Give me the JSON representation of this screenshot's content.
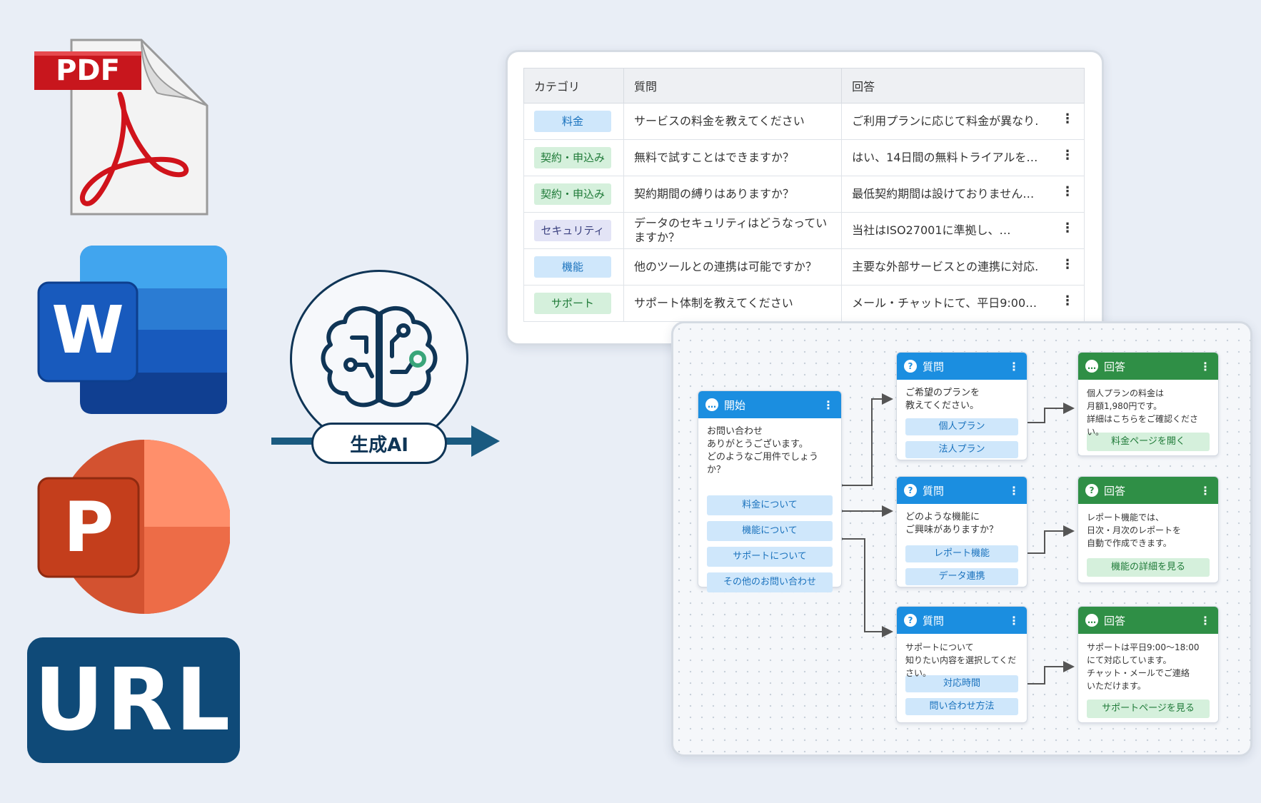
{
  "sources": {
    "pdf_label": "PDF",
    "word_letter": "W",
    "ppt_letter": "P",
    "url_label": "URL"
  },
  "ai": {
    "label": "生成AI"
  },
  "faq_table": {
    "headers": [
      "カテゴリ",
      "質問",
      "回答"
    ],
    "rows": [
      {
        "category": "料金",
        "question": "サービスの料金を教えてください",
        "answer": "ご利用プランに応じて料金が異なり…"
      },
      {
        "category": "契約・申込み",
        "question": "無料で試すことはできますか？",
        "answer": "はい、14日間の無料トライアルを…"
      },
      {
        "category": "契約・申込み",
        "question": "契約期間の縛りはありますか？",
        "answer": "最低契約期間は設けておりません…"
      },
      {
        "category": "セキュリティ",
        "question": "データのセキュリティはどうなっていますか？",
        "answer": "当社はISO27001に準拠し、…"
      },
      {
        "category": "機能",
        "question": "他のツールとの連携は可能ですか？",
        "answer": "主要な外部サービスとの連携に対応…"
      },
      {
        "category": "サポート",
        "question": "サポート体制を教えてください",
        "answer": "メール・チャットにて、平日9:00…"
      }
    ],
    "row_menu_glyph": "⋮"
  },
  "flow": {
    "start": {
      "title": "開始",
      "body": "お問い合わせ\nありがとうございます。\nどのようなご用件でしょうか？",
      "options": [
        "料金について",
        "機能について",
        "サポートについて",
        "その他のお問い合わせ"
      ]
    },
    "q1": {
      "title": "質問",
      "body": "ご希望のプランを\n教えてください。",
      "options": [
        "個人プラン",
        "法人プラン"
      ]
    },
    "q2": {
      "title": "質問",
      "body": "どのような機能に\nご興味がありますか？",
      "options": [
        "レポート機能",
        "データ連携"
      ]
    },
    "q3": {
      "title": "質問",
      "body": "サポートについて\n知りたい内容を選択してください。",
      "options": [
        "対応時間",
        "問い合わせ方法"
      ]
    },
    "a1": {
      "title": "回答",
      "body": "個人プランの料金は\n月額1,980円です。\n詳細はこちらをご確認ください。",
      "button": "料金ページを開く"
    },
    "a2": {
      "title": "回答",
      "body": "レポート機能では、\n日次・月次のレポートを\n自動で作成できます。",
      "button": "機能の詳細を見る"
    },
    "a3": {
      "title": "回答",
      "body": "サポートは平日9:00〜18:00\nにて対応しています。\nチャット・メールでご連絡\nいただけます。",
      "button": "サポートページを見る"
    },
    "menu_glyph": "⋮"
  },
  "colors": {
    "navy": "#0f3556",
    "flow_blue": "#1b8ee0",
    "flow_green": "#2f8f46",
    "pdf_red": "#c8161d",
    "word_blue": "#185abd",
    "ppt_orange": "#c43e1c",
    "url_navy": "#0f4a78",
    "teal_arrow": "#1a5a80"
  }
}
